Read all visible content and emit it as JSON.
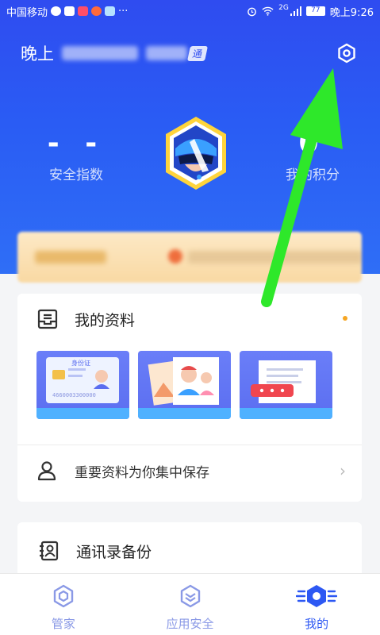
{
  "status_bar": {
    "carrier": "中国移动",
    "more": "···",
    "network": "2G",
    "battery": "77",
    "time": "晚上9:26"
  },
  "header": {
    "greeting": "晚上",
    "badge": "通"
  },
  "stats": {
    "security_value": "- -",
    "security_label": "安全指数",
    "points_value": "0",
    "points_label": "我的积分"
  },
  "card_profile": {
    "title": "我的资料",
    "id_card_title": "身份证",
    "id_card_number": "4660003300000",
    "row_text": "重要资料为你集中保存",
    "row_chevron": "›"
  },
  "card_contacts": {
    "title": "通讯录备份"
  },
  "tabs": [
    {
      "label": "管家",
      "active": false
    },
    {
      "label": "应用安全",
      "active": false
    },
    {
      "label": "我的",
      "active": true
    }
  ],
  "colors": {
    "hero": "#2f4cf0",
    "accent": "#2d58f3",
    "annotation_arrow": "#2ee82a",
    "dot": "#f6a623"
  }
}
